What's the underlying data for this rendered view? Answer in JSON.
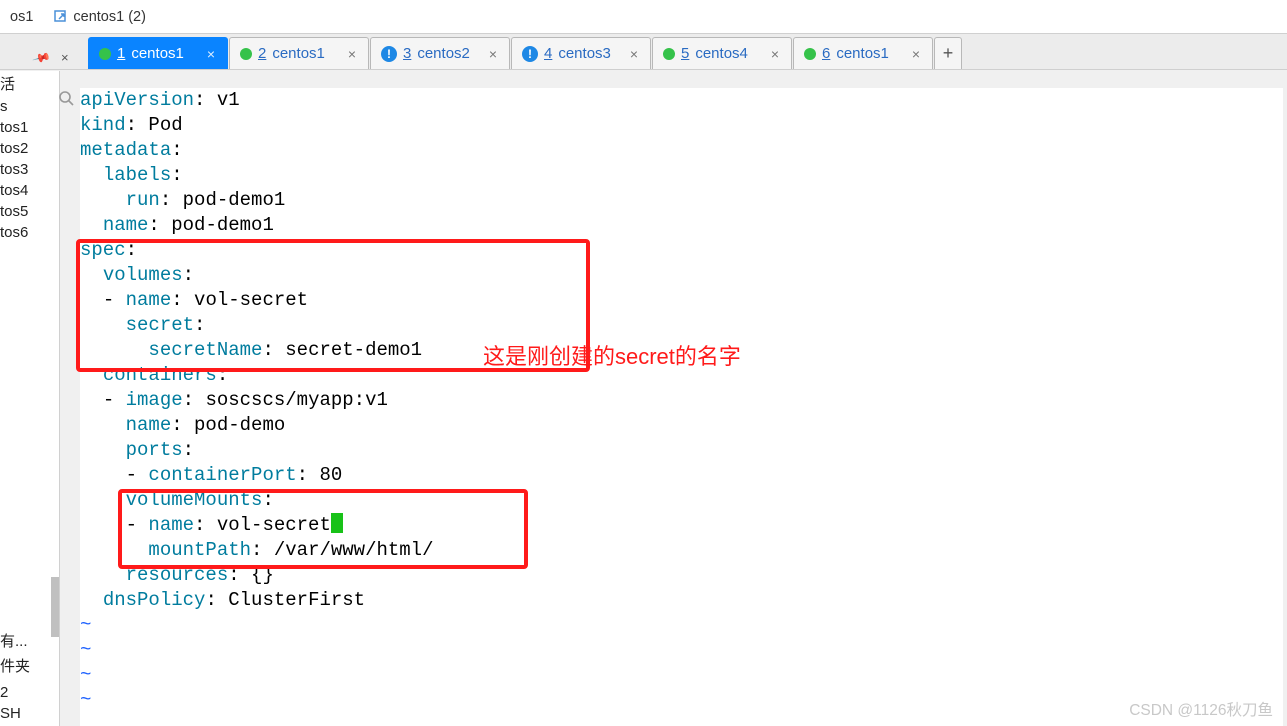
{
  "top_tabs": [
    "os1",
    "centos1 (2)"
  ],
  "pin_controls": {
    "pin": "📌",
    "close": "×"
  },
  "tabs": [
    {
      "num": "1",
      "label": "centos1",
      "status": "green",
      "active": true
    },
    {
      "num": "2",
      "label": "centos1",
      "status": "green",
      "active": false
    },
    {
      "num": "3",
      "label": "centos2",
      "status": "alert",
      "active": false
    },
    {
      "num": "4",
      "label": "centos3",
      "status": "alert",
      "active": false
    },
    {
      "num": "5",
      "label": "centos4",
      "status": "green",
      "active": false
    },
    {
      "num": "6",
      "label": "centos1",
      "status": "green",
      "active": false
    }
  ],
  "sidebar": {
    "items": [
      "活",
      "s",
      "tos1",
      "tos2",
      "tos3",
      "tos4",
      "tos5",
      "tos6"
    ],
    "lower": [
      "有...",
      "件夹",
      "",
      "2",
      "SH"
    ]
  },
  "code": [
    {
      "t": "kv",
      "indent": 0,
      "key": "apiVersion",
      "val": "v1"
    },
    {
      "t": "kv",
      "indent": 0,
      "key": "kind",
      "val": "Pod"
    },
    {
      "t": "k",
      "indent": 0,
      "key": "metadata"
    },
    {
      "t": "k",
      "indent": 1,
      "key": "labels"
    },
    {
      "t": "kv",
      "indent": 2,
      "key": "run",
      "val": "pod-demo1"
    },
    {
      "t": "kv",
      "indent": 1,
      "key": "name",
      "val": "pod-demo1"
    },
    {
      "t": "k",
      "indent": 0,
      "key": "spec"
    },
    {
      "t": "k",
      "indent": 1,
      "key": "volumes"
    },
    {
      "t": "dkv",
      "indent": 1,
      "key": "name",
      "val": "vol-secret"
    },
    {
      "t": "k",
      "indent": 2,
      "key": "secret"
    },
    {
      "t": "kv",
      "indent": 3,
      "key": "secretName",
      "val": "secret-demo1"
    },
    {
      "t": "k",
      "indent": 1,
      "key": "containers"
    },
    {
      "t": "dkv",
      "indent": 1,
      "key": "image",
      "val": "soscscs/myapp:v1"
    },
    {
      "t": "kv",
      "indent": 2,
      "key": "name",
      "val": "pod-demo"
    },
    {
      "t": "k",
      "indent": 2,
      "key": "ports"
    },
    {
      "t": "dkv",
      "indent": 2,
      "key": "containerPort",
      "val": "80"
    },
    {
      "t": "k",
      "indent": 2,
      "key": "volumeMounts"
    },
    {
      "t": "dkv",
      "indent": 2,
      "key": "name",
      "val": "vol-secret",
      "cursor": true
    },
    {
      "t": "kv",
      "indent": 3,
      "key": "mountPath",
      "val": "/var/www/html/"
    },
    {
      "t": "kv",
      "indent": 2,
      "key": "resources",
      "val": "{}"
    },
    {
      "t": "kv",
      "indent": 1,
      "key": "dnsPolicy",
      "val": "ClusterFirst"
    },
    {
      "t": "tilde"
    },
    {
      "t": "tilde"
    },
    {
      "t": "tilde"
    },
    {
      "t": "tilde"
    }
  ],
  "annotation_text": "这是刚创建的secret的名字",
  "watermark": "CSDN @1126秋刀鱼"
}
